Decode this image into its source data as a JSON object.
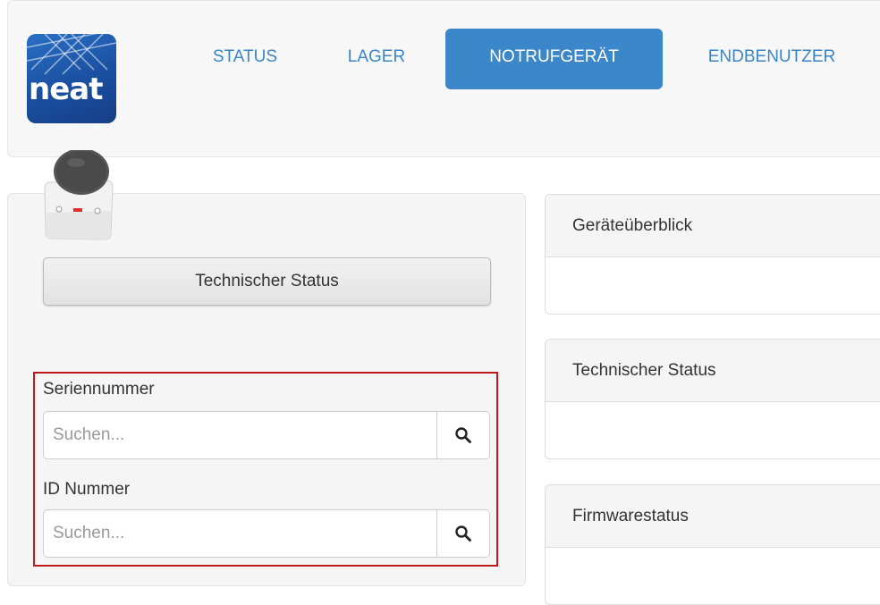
{
  "logo": {
    "text": "neat"
  },
  "nav": {
    "items": [
      {
        "label": "STATUS",
        "active": false
      },
      {
        "label": "LAGER",
        "active": false
      },
      {
        "label": "NOTRUFGERÄT",
        "active": true
      },
      {
        "label": "ENDBENUTZER",
        "active": false
      }
    ]
  },
  "left": {
    "status_button": "Technischer Status",
    "serial": {
      "label": "Seriennummer",
      "placeholder": "Suchen..."
    },
    "id": {
      "label": "ID Nummer",
      "placeholder": "Suchen..."
    }
  },
  "right": {
    "panels": [
      {
        "title": "Geräteüberblick"
      },
      {
        "title": "Technischer Status"
      },
      {
        "title": "Firmwarestatus"
      }
    ]
  },
  "colors": {
    "accent": "#3b87c9",
    "nav_text": "#3a86c8",
    "highlight_border": "#c0191c"
  }
}
